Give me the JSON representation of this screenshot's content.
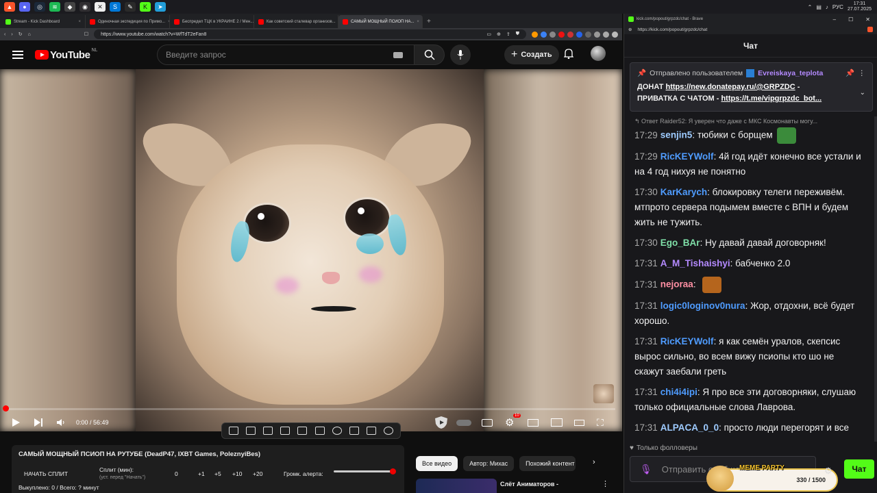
{
  "taskbar": {
    "icons": [
      "brave-icon",
      "discord-icon",
      "steam-icon",
      "spotify-icon",
      "game-icon",
      "obs-icon",
      "app-icon",
      "skype-icon",
      "tool-icon",
      "kick-icon",
      "telegram-icon"
    ],
    "lang": "РУС",
    "time": "17:31",
    "date": "27.07.2025"
  },
  "browser": {
    "tabs": [
      {
        "label": "Stream - Kick Dashboard",
        "color": "#53fc18"
      },
      {
        "label": "Одиночная экспедиция по Примо...",
        "color": "#ff0000"
      },
      {
        "label": "Беспредел ТЦК в УКРАИНЕ 2 / Мен...",
        "color": "#ff0000"
      },
      {
        "label": "Как советский сталевар организов...",
        "color": "#ff0000"
      },
      {
        "label": "САМЫЙ МОЩНЫЙ ПСИОП НА...",
        "color": "#ff0000"
      }
    ],
    "url": "https://www.youtube.com/watch?v=WfTdT2eFan8"
  },
  "youtube": {
    "logo_text": "YouTube",
    "region": "NL",
    "search_placeholder": "Введите запрос",
    "create_label": "Создать",
    "player": {
      "time": "0:00 / 56:49",
      "progress": 0.0,
      "notification_badge": "10"
    },
    "split": {
      "title": "САМЫЙ МОЩНЫЙ ПСИОП НА РУТУБЕ (DeadP47, IXBT Games, PoleznyiBes)",
      "start_label": "НАЧАТЬ СПЛИТ",
      "split_min_label": "Сплит (мин):",
      "split_hint": "(уст. перед \"Начать\")",
      "value": "0",
      "increments": [
        "+1",
        "+5",
        "+10",
        "+20"
      ],
      "alert_volume_label": "Громк. алерта:",
      "alert_volume": 1.0,
      "footer": "Выкуплено: 0 / Всего: ? минут"
    },
    "chips": [
      "Все видео",
      "Автор: Михас",
      "Похожий контент"
    ],
    "related_title": "Слёт Аниматоров -"
  },
  "chat": {
    "window_title": "kick.com/popout/grpzdc/chat - Brave",
    "url": "https://kick.com/popout/grpzdc/chat",
    "header": "Чат",
    "pinned": {
      "prefix": "Отправлено пользователем",
      "user": "Evreiskaya_teplota",
      "line1_text": "ДОНАТ ",
      "line1_link": "https://new.donatepay.ru/@GRPZDC",
      "line1_suffix": " -",
      "line2_text": "ПРИВАТКА С ЧАТОМ - ",
      "line2_link": "https://t.me/vipgrpzdc_bot..."
    },
    "reply_preview": "Ответ Raider52: Я уверен что даже с МКС Космонавты могу...",
    "messages": [
      {
        "time": "17:29",
        "user": "senjin5",
        "color": "#9ecbff",
        "text": "тюбики с борщем",
        "emote": true
      },
      {
        "time": "17:29",
        "user": "RicKEYWolf",
        "color": "#4f9cff",
        "text": "4й год идёт конечно все устали и на 4 год нихуя не понятно"
      },
      {
        "time": "17:30",
        "user": "KarKarych",
        "color": "#4f9cff",
        "text": "блокировку телеги переживём. мтпрото сервера подымем вместе с ВПН и будем жить не тужить."
      },
      {
        "time": "17:30",
        "user": "Ego_BAr",
        "color": "#7fe0a8",
        "text": "Ну давай давай договорняк!"
      },
      {
        "time": "17:31",
        "user": "A_M_Tishaishyi",
        "color": "#b48aff",
        "text": "бабченко 2.0"
      },
      {
        "time": "17:31",
        "user": "nejoraa",
        "color": "#ff8fa3",
        "text": "",
        "emote": true
      },
      {
        "time": "17:31",
        "user": "logic0loginov0nura",
        "color": "#4f9cff",
        "text": "Жор, отдохни, всё будет хорошо."
      },
      {
        "time": "17:31",
        "user": "RicKEYWolf",
        "color": "#4f9cff",
        "text": "я как семён уралов, скепсис вырос сильно, во всем вижу псиопы кто шо не скажут заебали греть"
      },
      {
        "time": "17:31",
        "user": "chi4i4ipi",
        "color": "#4f9cff",
        "text": "Я про все эти договорняки, слушаю только официальные слова Лаврова."
      },
      {
        "time": "17:31",
        "user": "ALPACA_0_0",
        "color": "#9ecbff",
        "text": "просто люди перегорят и все"
      }
    ],
    "followers_only": "Только фолловеры",
    "input_placeholder": "Отправить сообщение...",
    "send_label": "Чат",
    "meme_party": {
      "label": "MEME PARTY",
      "count": "330 / 1500"
    }
  }
}
